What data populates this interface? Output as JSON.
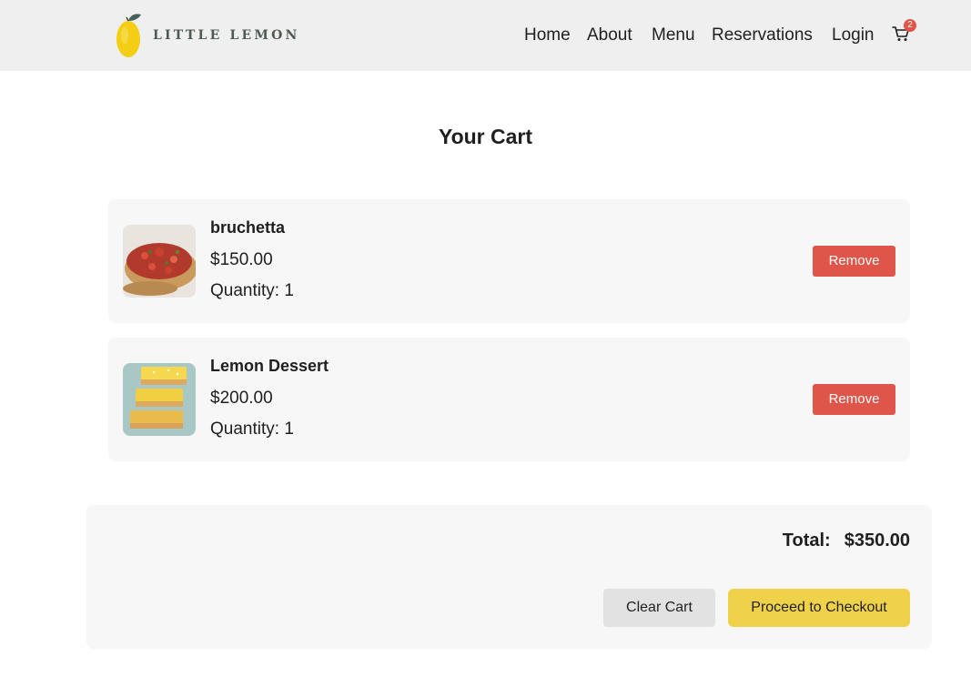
{
  "brand": {
    "logo_text": "LITTLE LEMON",
    "accent": "#f0d14a",
    "lemon_color": "#f4ce14",
    "leaf_color": "#495e57"
  },
  "nav": {
    "links": [
      "Home",
      "About",
      "Menu",
      "Reservations",
      "Login"
    ],
    "cart_icon": "cart-icon",
    "cart_count": "2",
    "badge_color": "#e0554a"
  },
  "page": {
    "title": "Your Cart"
  },
  "cart": {
    "items": [
      {
        "name": "bruchetta",
        "price": "$150.00",
        "quantity_label": "Quantity: 1",
        "image": "bruschetta-image",
        "remove_label": "Remove"
      },
      {
        "name": "Lemon Dessert",
        "price": "$200.00",
        "quantity_label": "Quantity: 1",
        "image": "lemon-dessert-image",
        "remove_label": "Remove"
      }
    ]
  },
  "summary": {
    "total_label": "Total:",
    "total_value": "$350.00",
    "clear_label": "Clear Cart",
    "checkout_label": "Proceed to Checkout"
  },
  "colors": {
    "nav_bg": "#efefef",
    "card_bg": "#f7f7f7",
    "remove": "#e0554a",
    "clear": "#e2e2e2",
    "checkout": "#f0d14a"
  }
}
